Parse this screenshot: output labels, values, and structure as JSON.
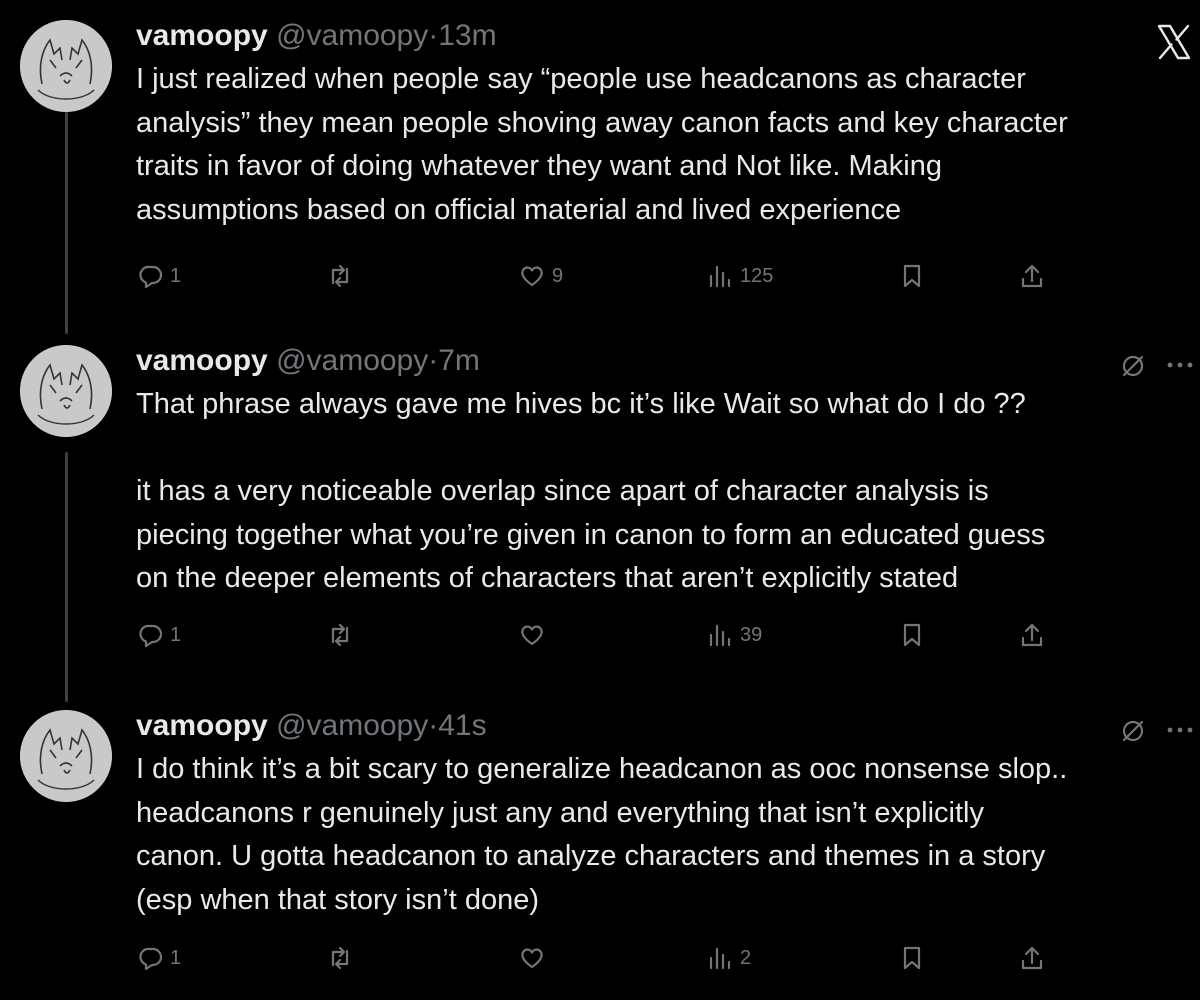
{
  "brand": {
    "logo": "x-logo-icon"
  },
  "tweets": [
    {
      "name": "vamoopy",
      "handle": "@vamoopy",
      "separator": "·",
      "time": "13m",
      "text": "I just realized when people say “people use headcanons as character\nanalysis” they mean people shoving away canon facts and key character\ntraits in favor of doing whatever they want and Not like. Making\nassumptions based on official material and lived experience",
      "replies": "1",
      "retweets": "",
      "likes": "9",
      "views": "125"
    },
    {
      "name": "vamoopy",
      "handle": "@vamoopy",
      "separator": "·",
      "time": "7m",
      "text": "That phrase always gave me hives bc it’s like Wait so what do I do ??\n\nit has a very noticeable overlap since apart of character analysis is\npiecing together what you’re given in canon to form an educated guess\non the deeper elements of characters that aren’t explicitly stated",
      "replies": "1",
      "retweets": "",
      "likes": "",
      "views": "39"
    },
    {
      "name": "vamoopy",
      "handle": "@vamoopy",
      "separator": "·",
      "time": "41s",
      "text": "I do think it’s a bit scary to generalize headcanon as ooc nonsense slop..\nheadcanons r genuinely just any and everything that isn’t explicitly\ncanon. U gotta headcanon to analyze characters and themes in a story\n(esp when that story isn’t done)",
      "replies": "1",
      "retweets": "",
      "likes": "",
      "views": "2"
    }
  ],
  "icons": {
    "reply": "reply-icon",
    "retweet": "retweet-icon",
    "like": "heart-icon",
    "views": "views-icon",
    "bookmark": "bookmark-icon",
    "share": "share-icon",
    "edit": "edit-slash-icon",
    "more": "more-icon"
  },
  "colors": {
    "background": "#000000",
    "text": "#e7e9ea",
    "muted": "#71767b",
    "thread": "#3e4144"
  }
}
